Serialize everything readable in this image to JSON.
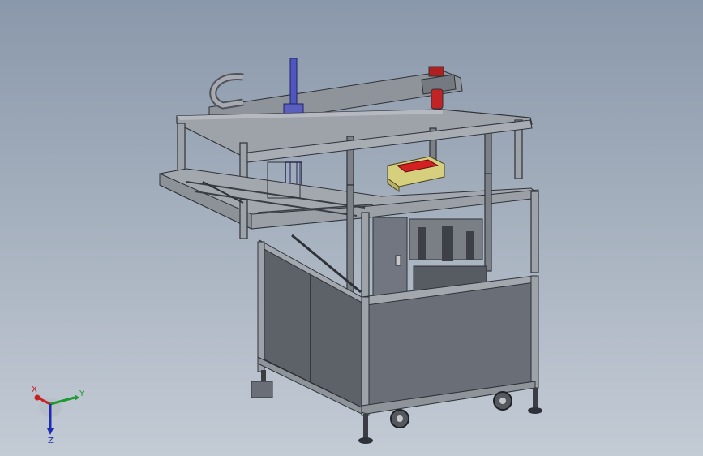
{
  "viewport": {
    "background_top": "#8a98ab",
    "background_bottom": "#c3cbd5"
  },
  "model": {
    "frame_color": "#9ea3aa",
    "panel_color": "#5d6168",
    "cylinder_color": "#5a5fc0",
    "tray_color": "#d6cf7e",
    "tray_insert_color": "#d42020",
    "motor_color": "#c02424"
  },
  "triad": {
    "x_label": "X",
    "y_label": "Y",
    "z_label": "Z",
    "x_color": "#c82020",
    "y_color": "#1f9a2f",
    "z_color": "#1e2bb0"
  }
}
